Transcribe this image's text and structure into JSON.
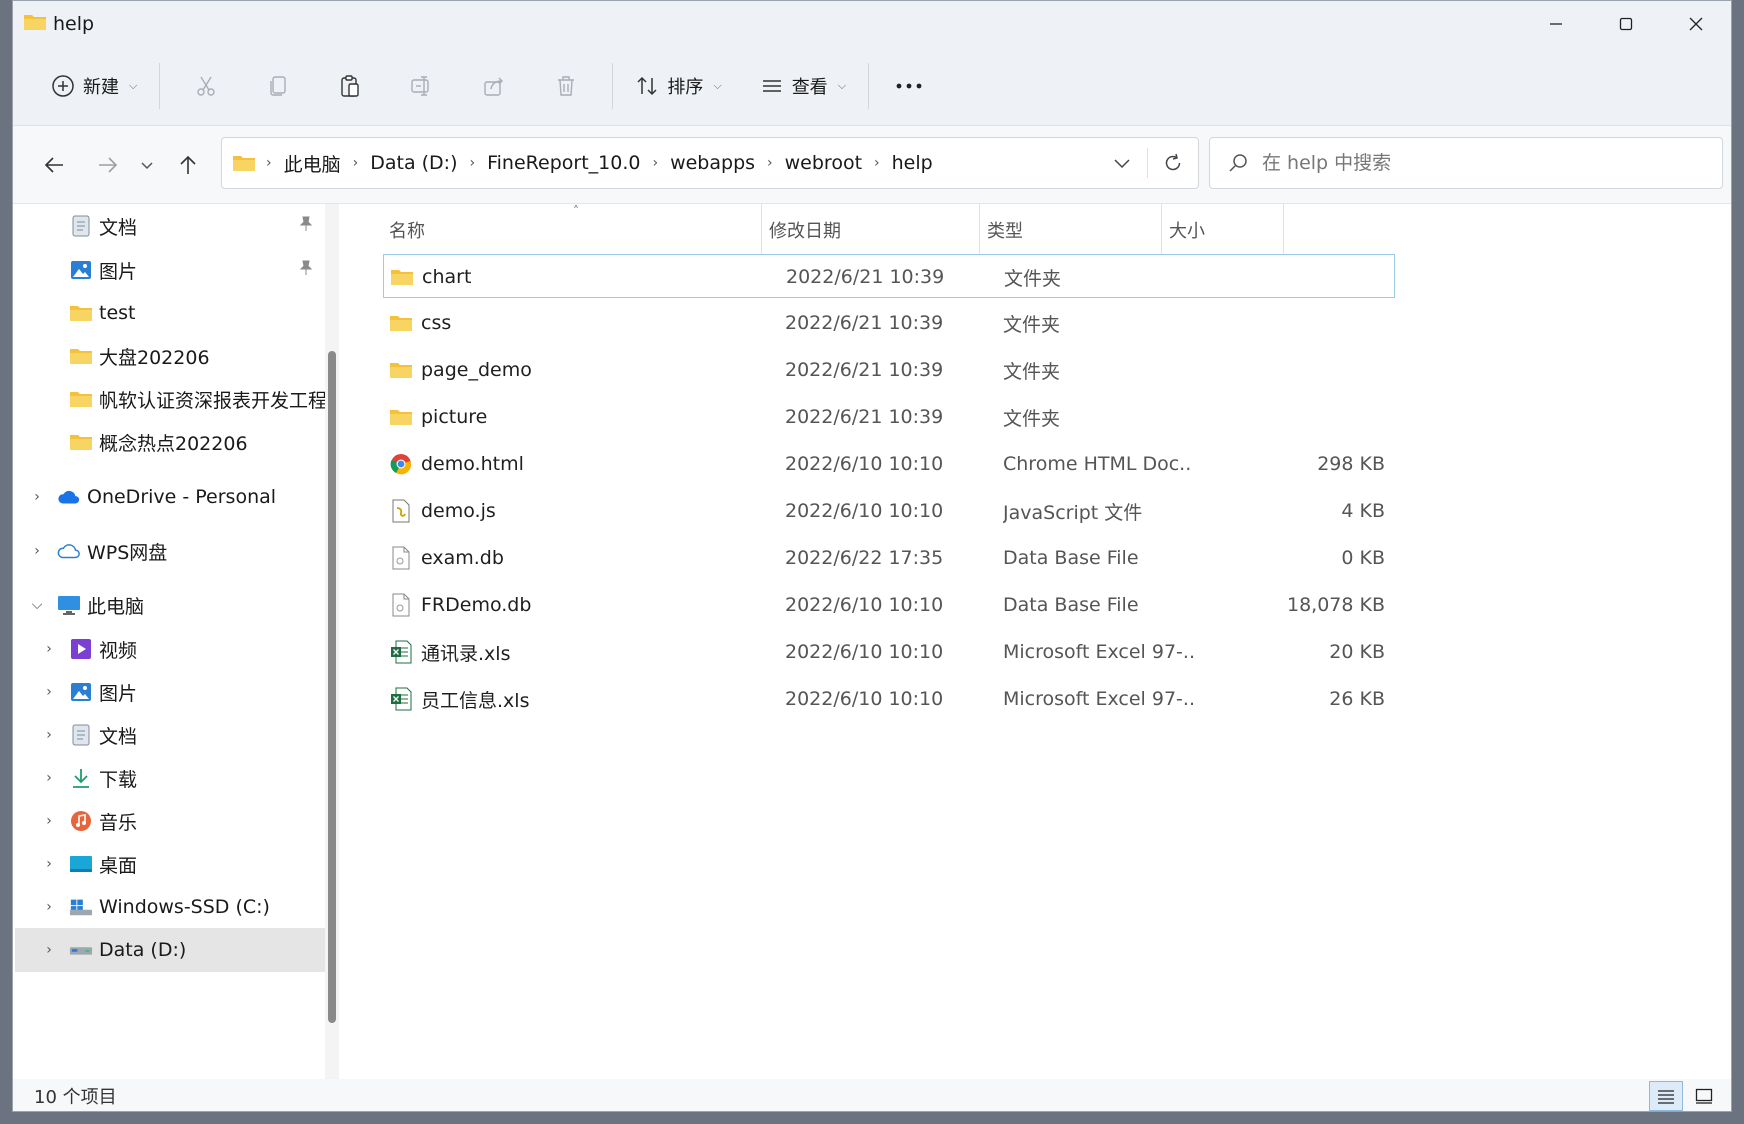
{
  "window": {
    "title": "help"
  },
  "toolbar": {
    "new_label": "新建",
    "sort_label": "排序",
    "view_label": "查看"
  },
  "address": {
    "crumbs": [
      "此电脑",
      "Data (D:)",
      "FineReport_10.0",
      "webapps",
      "webroot",
      "help"
    ]
  },
  "search": {
    "placeholder": "在 help 中搜索"
  },
  "sidebar": {
    "items": [
      {
        "label": "文档",
        "icon": "documents-icon",
        "pinned": true
      },
      {
        "label": "图片",
        "icon": "pictures-icon",
        "pinned": true
      },
      {
        "label": "test",
        "icon": "folder-icon"
      },
      {
        "label": "大盘202206",
        "icon": "folder-icon"
      },
      {
        "label": "帆软认证资深报表开发工程师",
        "icon": "folder-icon"
      },
      {
        "label": "概念热点202206",
        "icon": "folder-icon"
      },
      {
        "label": "OneDrive - Personal",
        "icon": "onedrive-icon"
      },
      {
        "label": "WPS网盘",
        "icon": "wps-cloud-icon"
      },
      {
        "label": "此电脑",
        "icon": "this-pc-icon"
      },
      {
        "label": "视频",
        "icon": "videos-icon"
      },
      {
        "label": "图片",
        "icon": "pictures-icon"
      },
      {
        "label": "文档",
        "icon": "documents-icon"
      },
      {
        "label": "下载",
        "icon": "downloads-icon"
      },
      {
        "label": "音乐",
        "icon": "music-icon"
      },
      {
        "label": "桌面",
        "icon": "desktop-icon"
      },
      {
        "label": "Windows-SSD (C:)",
        "icon": "drive-c-icon"
      },
      {
        "label": "Data (D:)",
        "icon": "drive-d-icon",
        "selected": true
      }
    ]
  },
  "columns": {
    "name": "名称",
    "date": "修改日期",
    "type": "类型",
    "size": "大小"
  },
  "files": [
    {
      "name": "chart",
      "date": "2022/6/21 10:39",
      "type": "文件夹",
      "size": "",
      "icon": "folder-icon"
    },
    {
      "name": "css",
      "date": "2022/6/21 10:39",
      "type": "文件夹",
      "size": "",
      "icon": "folder-icon"
    },
    {
      "name": "page_demo",
      "date": "2022/6/21 10:39",
      "type": "文件夹",
      "size": "",
      "icon": "folder-icon"
    },
    {
      "name": "picture",
      "date": "2022/6/21 10:39",
      "type": "文件夹",
      "size": "",
      "icon": "folder-icon"
    },
    {
      "name": "demo.html",
      "date": "2022/6/10 10:10",
      "type": "Chrome HTML Doc...",
      "size": "298 KB",
      "icon": "chrome-icon"
    },
    {
      "name": "demo.js",
      "date": "2022/6/10 10:10",
      "type": "JavaScript 文件",
      "size": "4 KB",
      "icon": "js-file-icon"
    },
    {
      "name": "exam.db",
      "date": "2022/6/22 17:35",
      "type": "Data Base File",
      "size": "0 KB",
      "icon": "db-file-icon"
    },
    {
      "name": "FRDemo.db",
      "date": "2022/6/10 10:10",
      "type": "Data Base File",
      "size": "18,078 KB",
      "icon": "db-file-icon"
    },
    {
      "name": "通讯录.xls",
      "date": "2022/6/10 10:10",
      "type": "Microsoft Excel 97-...",
      "size": "20 KB",
      "icon": "excel-icon"
    },
    {
      "name": "员工信息.xls",
      "date": "2022/6/10 10:10",
      "type": "Microsoft Excel 97-...",
      "size": "26 KB",
      "icon": "excel-icon"
    }
  ],
  "status": {
    "item_count": "10 个项目"
  },
  "colors": {
    "folder": "#f3c13a",
    "selection_border": "#9ccbea",
    "accent": "#0067c0"
  }
}
